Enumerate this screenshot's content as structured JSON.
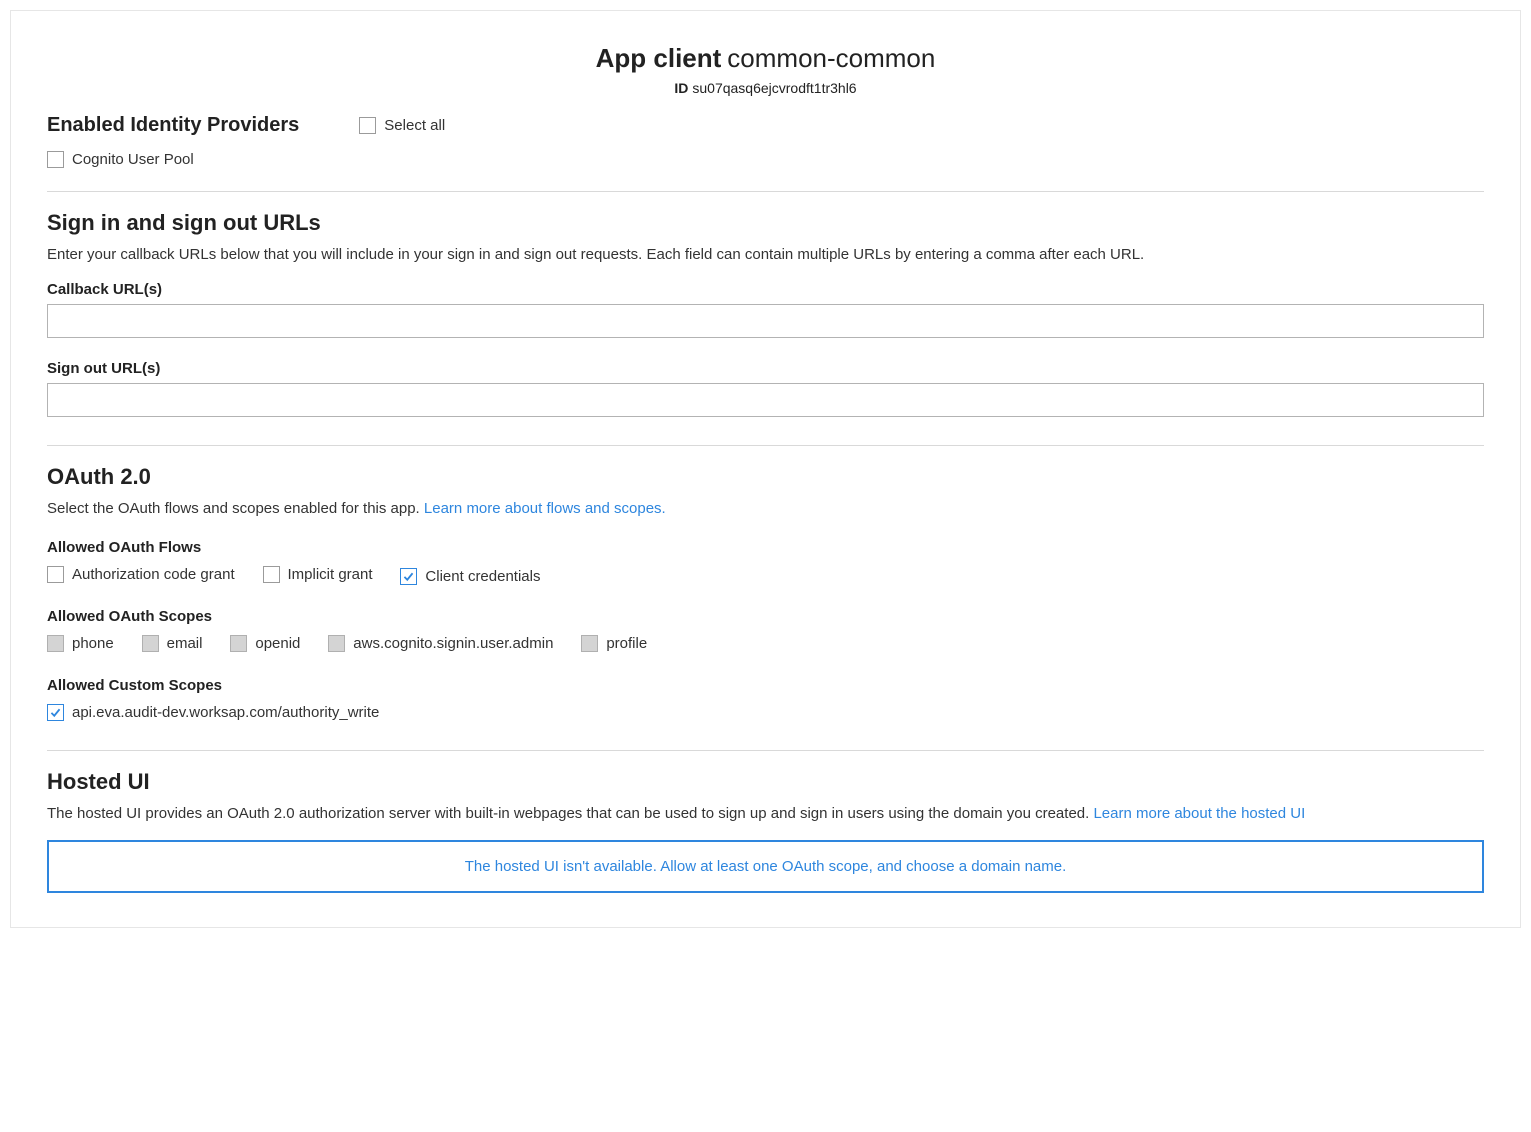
{
  "header": {
    "title_prefix": "App client",
    "client_name": "common-common",
    "id_label": "ID",
    "id_value": "su07qasq6ejcvrodft1tr3hl6"
  },
  "idp": {
    "heading": "Enabled Identity Providers",
    "select_all_label": "Select all",
    "providers": [
      {
        "label": "Cognito User Pool",
        "checked": false
      }
    ]
  },
  "urls": {
    "heading": "Sign in and sign out URLs",
    "description": "Enter your callback URLs below that you will include in your sign in and sign out requests. Each field can contain multiple URLs by entering a comma after each URL.",
    "callback_label": "Callback URL(s)",
    "callback_value": "",
    "signout_label": "Sign out URL(s)",
    "signout_value": ""
  },
  "oauth": {
    "heading": "OAuth 2.0",
    "description_prefix": "Select the OAuth flows and scopes enabled for this app. ",
    "learn_link": "Learn more about flows and scopes.",
    "flows_label": "Allowed OAuth Flows",
    "flows": [
      {
        "label": "Authorization code grant",
        "checked": false,
        "disabled": false
      },
      {
        "label": "Implicit grant",
        "checked": false,
        "disabled": false
      },
      {
        "label": "Client credentials",
        "checked": true,
        "disabled": false
      }
    ],
    "scopes_label": "Allowed OAuth Scopes",
    "scopes": [
      {
        "label": "phone",
        "checked": false,
        "disabled": true
      },
      {
        "label": "email",
        "checked": false,
        "disabled": true
      },
      {
        "label": "openid",
        "checked": false,
        "disabled": true
      },
      {
        "label": "aws.cognito.signin.user.admin",
        "checked": false,
        "disabled": true
      },
      {
        "label": "profile",
        "checked": false,
        "disabled": true
      }
    ],
    "custom_scopes_label": "Allowed Custom Scopes",
    "custom_scopes": [
      {
        "label": "api.eva.audit-dev.worksap.com/authority_write",
        "checked": true,
        "disabled": false
      }
    ]
  },
  "hosted": {
    "heading": "Hosted UI",
    "description_prefix": "The hosted UI provides an OAuth 2.0 authorization server with built-in webpages that can be used to sign up and sign in users using the domain you created. ",
    "learn_link": "Learn more about the hosted UI",
    "banner": "The hosted UI isn't available. Allow at least one OAuth scope, and choose a domain name."
  }
}
